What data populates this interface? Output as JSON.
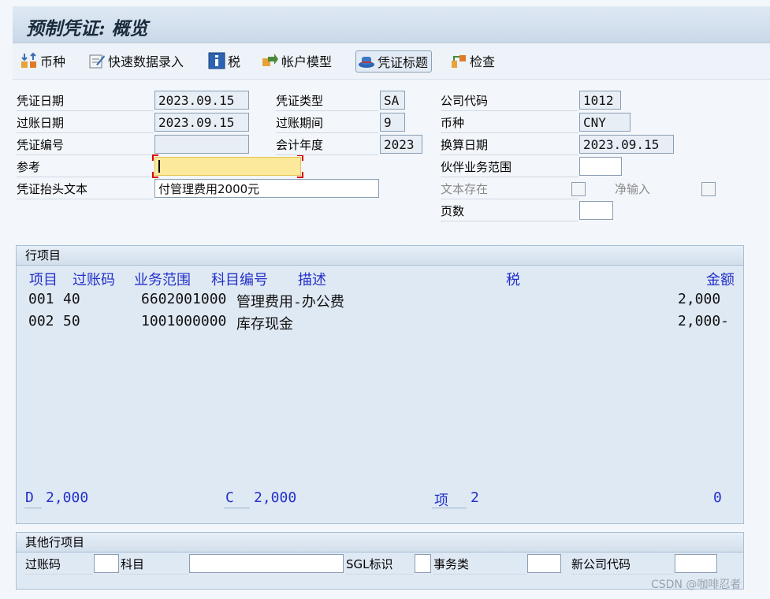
{
  "window": {
    "title": "预制凭证: 概览"
  },
  "toolbar": {
    "currency": "币种",
    "fast_entry": "快速数据录入",
    "tax": "税",
    "account_model": "帐户模型",
    "doc_header": "凭证标题",
    "check": "检查"
  },
  "header": {
    "doc_date_label": "凭证日期",
    "doc_date": "2023.09.15",
    "doc_type_label": "凭证类型",
    "doc_type": "SA",
    "company_code_label": "公司代码",
    "company_code": "1012",
    "posting_date_label": "过账日期",
    "posting_date": "2023.09.15",
    "posting_period_label": "过账期间",
    "posting_period": "9",
    "currency_label": "币种",
    "currency": "CNY",
    "doc_number_label": "凭证编号",
    "doc_number": "",
    "fiscal_year_label": "会计年度",
    "fiscal_year": "2023",
    "translation_date_label": "换算日期",
    "translation_date": "2023.09.15",
    "reference_label": "参考",
    "reference": "",
    "trading_partner_label": "伙伴业务范围",
    "trading_partner": "",
    "header_text_label": "凭证抬头文本",
    "header_text": "付管理费用2000元",
    "text_exists_label": "文本存在",
    "net_entry_label": "净输入",
    "pages_label": "页数",
    "pages": ""
  },
  "items_group": {
    "title": "行项目",
    "columns": {
      "item": "项目",
      "posting_key": "过账码",
      "business_area": "业务范围",
      "account": "科目编号",
      "description": "描述",
      "tax": "税",
      "amount": "金额"
    },
    "rows": [
      {
        "item": "001",
        "pk": "40",
        "account": "6602001000",
        "description": "管理费用-办公费",
        "amount": "2,000"
      },
      {
        "item": "002",
        "pk": "50",
        "account": "1001000000",
        "description": "库存现金",
        "amount": "2,000-"
      }
    ],
    "totals": {
      "debit_label": "D",
      "debit": "2,000",
      "credit_label": "C",
      "credit": "2,000",
      "items_label": "项",
      "items": "2",
      "balance": "0"
    }
  },
  "other_group": {
    "title": "其他行项目",
    "posting_key_label": "过账码",
    "account_label": "科目",
    "sgl_label": "SGL标识",
    "transaction_type_label": "事务类",
    "new_company_label": "新公司代码"
  },
  "watermark": "CSDN @咖啡忍者"
}
